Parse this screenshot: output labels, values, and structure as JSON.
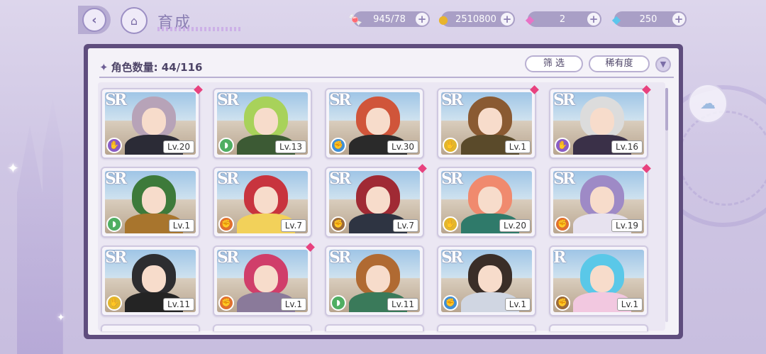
{
  "header": {
    "title": "育成",
    "back_glyph": "‹",
    "home_glyph": "⌂"
  },
  "resources": [
    {
      "name": "candy",
      "icon": "candy-icon",
      "glyph": "🍬",
      "value": "945/78"
    },
    {
      "name": "gold",
      "icon": "coin-icon",
      "glyph": "●",
      "value": "2510800"
    },
    {
      "name": "pink_gem",
      "icon": "pink-diamond-icon",
      "glyph": "◆",
      "value": "2"
    },
    {
      "name": "blue_gem",
      "icon": "blue-diamond-icon",
      "glyph": "◆",
      "value": "250"
    }
  ],
  "panel": {
    "count_label": "角色数量: 44/116",
    "filter_label": "筛 选",
    "sort_label": "稀有度"
  },
  "colors": {
    "purple": "#8a5cc4",
    "green": "#4fae62",
    "blue": "#3f8fd6",
    "brown": "#9a6a3a",
    "yellow": "#e2b62e",
    "orange": "#e0702f"
  },
  "cards": [
    {
      "rarity": "SR",
      "level": "Lv.20",
      "element": "purple",
      "new": true,
      "hair": "#b7a3b8",
      "body": "#2b2b36"
    },
    {
      "rarity": "SR",
      "level": "Lv.13",
      "element": "green",
      "new": false,
      "hair": "#a8d25a",
      "body": "#3c5a34"
    },
    {
      "rarity": "SR",
      "level": "Lv.30",
      "element": "blue",
      "new": false,
      "hair": "#d0553a",
      "body": "#2a2a2a"
    },
    {
      "rarity": "SR",
      "level": "Lv.1",
      "element": "yellow",
      "new": true,
      "hair": "#8a5a32",
      "body": "#5a4a2a"
    },
    {
      "rarity": "SR",
      "level": "Lv.16",
      "element": "purple",
      "new": true,
      "hair": "#dcdcdc",
      "body": "#3a3048"
    },
    {
      "rarity": "SR",
      "level": "Lv.1",
      "element": "green",
      "new": false,
      "hair": "#3d7a3a",
      "body": "#a8752d"
    },
    {
      "rarity": "SR",
      "level": "Lv.7",
      "element": "orange",
      "new": false,
      "hair": "#c8343e",
      "body": "#f2d15a"
    },
    {
      "rarity": "SR",
      "level": "Lv.7",
      "element": "brown",
      "new": true,
      "hair": "#a02a34",
      "body": "#2e3442"
    },
    {
      "rarity": "SR",
      "level": "Lv.20",
      "element": "yellow",
      "new": false,
      "hair": "#f08a6e",
      "body": "#2f7a6a"
    },
    {
      "rarity": "SR",
      "level": "Lv.19",
      "element": "orange",
      "new": true,
      "hair": "#9e8ac6",
      "body": "#e7e2ef"
    },
    {
      "rarity": "SR",
      "level": "Lv.11",
      "element": "yellow",
      "new": false,
      "hair": "#2d2d30",
      "body": "#242424"
    },
    {
      "rarity": "SR",
      "level": "Lv.1",
      "element": "orange",
      "new": true,
      "hair": "#d03e6a",
      "body": "#8a7a9a"
    },
    {
      "rarity": "SR",
      "level": "Lv.11",
      "element": "green",
      "new": false,
      "hair": "#b06a32",
      "body": "#3a7a5a"
    },
    {
      "rarity": "SR",
      "level": "Lv.1",
      "element": "blue",
      "new": false,
      "hair": "#3a2e28",
      "body": "#d0d6e2"
    },
    {
      "rarity": "R",
      "level": "Lv.1",
      "element": "brown",
      "new": false,
      "hair": "#5ac8e8",
      "body": "#f2c8e0"
    }
  ],
  "side_button": {
    "icon": "pet-icon",
    "glyph": "☁"
  }
}
